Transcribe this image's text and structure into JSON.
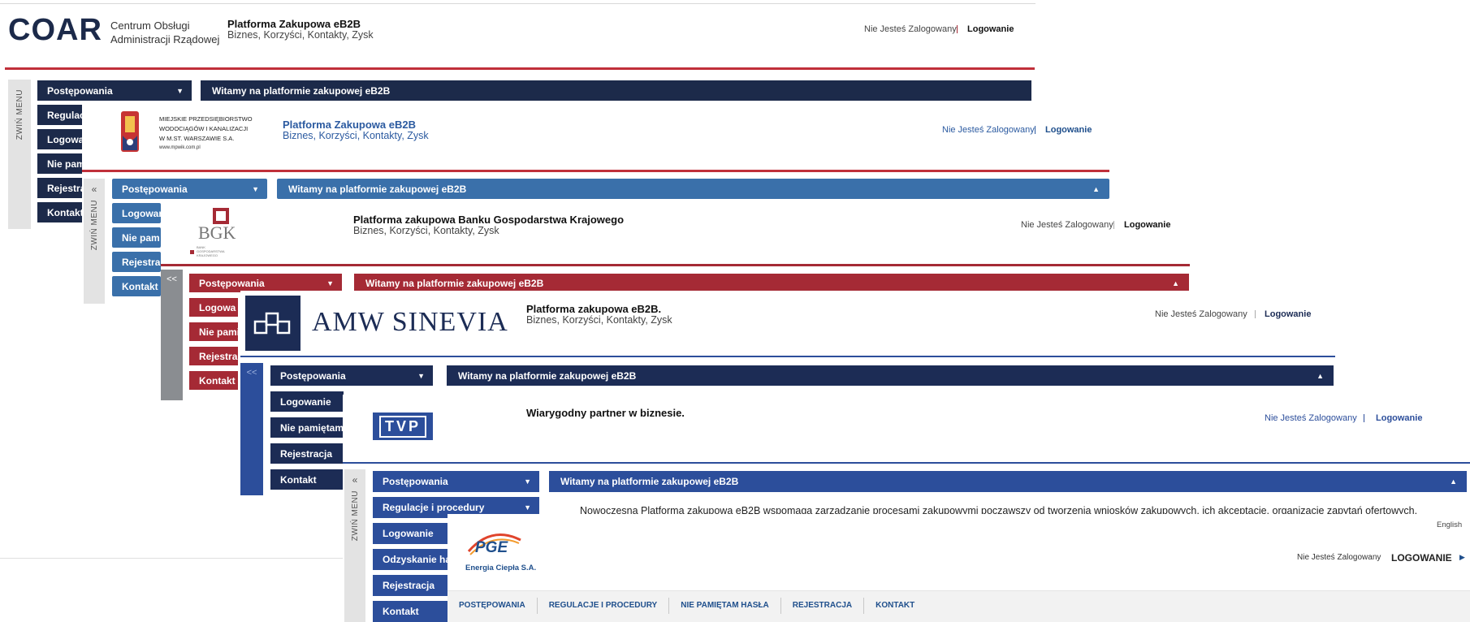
{
  "common": {
    "login_status": "Nie Jesteś Zalogowany",
    "login_link": "Logowanie",
    "subtitle": "Biznes, Korzyści, Kontakty, Zysk",
    "welcome": "Witamy na platformie zakupowej eB2B",
    "collapse_menu": "ZWIŃ MENU"
  },
  "coar": {
    "logo_text": "COAR",
    "org_line1": "Centrum Obsługi",
    "org_line2": "Administracji Rządowej",
    "title": "Platforma Zakupowa eB2B",
    "menu": [
      "Postępowania",
      "Regulac",
      "Logowa",
      "Nie pam",
      "Rejestra",
      "Kontakt"
    ]
  },
  "mpwik": {
    "org_lines": [
      "MIEJSKIE PRZEDSIĘBIORSTWO",
      "WODOCIĄGÓW I KANALIZACJI",
      "W M.ST. WARSZAWIE S.A.",
      "www.mpwik.com.pl"
    ],
    "title": "Platforma Zakupowa eB2B",
    "menu": [
      "Postępowania",
      "Logowan",
      "Nie pam",
      "Rejestra",
      "Kontakt"
    ]
  },
  "bgk": {
    "logo_text": "BGK",
    "logo_sub": "BANK GOSPODARSTWA KRAJOWEGO",
    "title": "Platforma zakupowa Banku Gospodarstwa Krajowego",
    "collapse": "<<",
    "menu": [
      "Postępowania",
      "Logowa",
      "Nie pami",
      "Rejestra",
      "Kontakt"
    ]
  },
  "amw": {
    "logo_text": "AMW SINEVIA",
    "title": "Platforma zakupowa eB2B.",
    "collapse": "<<",
    "menu": [
      "Postępowania",
      "Logowanie",
      "Nie pamiętam",
      "Rejestracja",
      "Kontakt"
    ]
  },
  "tvp": {
    "logo_text": "TVP",
    "title": "Wiarygodny partner w biznesie.",
    "menu": [
      "Postępowania",
      "Regulacje i procedury",
      "Logowanie",
      "Odzyskanie ha",
      "Rejestracja",
      "Kontakt"
    ],
    "body_text": "Nowoczesna Platforma zakupowa eB2B wspomaga zarządzanie procesami zakupowymi począwszy od tworzenia wniosków zakupowych, ich akceptację, organizację zapytań ofertowych,"
  },
  "pge": {
    "language": "English",
    "logo_text": "PGE",
    "logo_sub": "Energia Ciepła S.A.",
    "login_link": "LOGOWANIE",
    "nav": [
      "POSTĘPOWANIA",
      "REGULACJE I PROCEDURY",
      "NIE PAMIĘTAM HASŁA",
      "REJESTRACJA",
      "KONTAKT"
    ]
  },
  "colors": {
    "coar_navy": "#1c2a4a",
    "mpwik_blue": "#3a70aa",
    "bgk_red": "#a52a35",
    "amw_navy": "#1c2c55",
    "tvp_blue": "#2c4e9b",
    "pge_blue": "#1f4f8c"
  }
}
